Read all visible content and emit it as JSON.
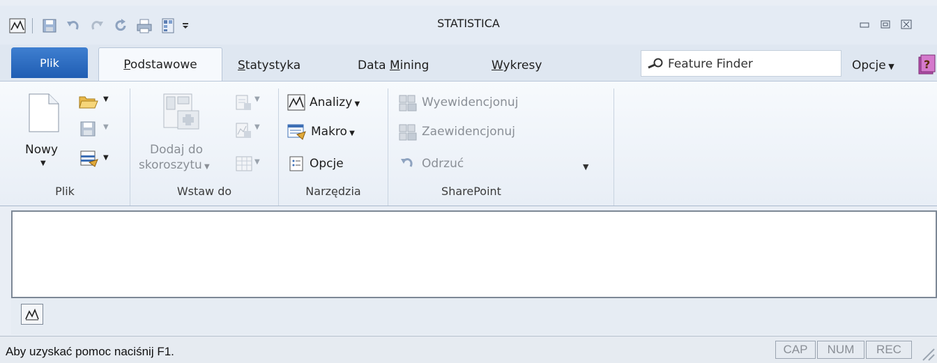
{
  "window": {
    "title": "STATISTICA",
    "controls": [
      "minimize-icon",
      "restore-icon",
      "close-icon"
    ]
  },
  "quick_access": {
    "icons": [
      "statistica-logo-icon",
      "save-icon",
      "undo-icon",
      "redo-icon",
      "refresh-icon",
      "print-icon",
      "layout-icon",
      "customize-dropdown-icon"
    ]
  },
  "tabs": {
    "file": "Plik",
    "items": [
      {
        "label": "Podstawowe",
        "accel": "P",
        "rest": "odstawowe",
        "active": true
      },
      {
        "label": "Statystyka",
        "accel": "S",
        "rest": "tatystyka",
        "active": false
      },
      {
        "label": "Data Mining",
        "pre": "Data ",
        "accel": "M",
        "rest": "ining",
        "active": false
      },
      {
        "label": "Wykresy",
        "accel": "W",
        "rest": "ykresy",
        "active": false
      }
    ],
    "search_placeholder": "Feature Finder",
    "options_menu": "Opcje"
  },
  "ribbon": {
    "groups": {
      "plik": {
        "label": "Plik",
        "new_button": "Nowy"
      },
      "wstaw": {
        "label": "Wstaw do",
        "add_line1": "Dodaj do",
        "add_line2": "skoroszytu"
      },
      "narzedzia": {
        "label": "Narzędzia",
        "analyses": "Analizy",
        "macro": "Makro",
        "options": "Opcje"
      },
      "sharepoint": {
        "label": "SharePoint",
        "check_in": "Wyewidencjonuj",
        "check_out": "Zaewidencjonuj",
        "discard": "Odrzuć"
      }
    }
  },
  "statusbar": {
    "text": "Aby uzyskać pomoc naciśnij F1.",
    "indicators": [
      "CAP",
      "NUM",
      "REC"
    ]
  },
  "colors": {
    "file_tab": "#2a6bc4",
    "ribbon_bg": "#eef3f9",
    "disabled_text": "#8a8f96"
  }
}
